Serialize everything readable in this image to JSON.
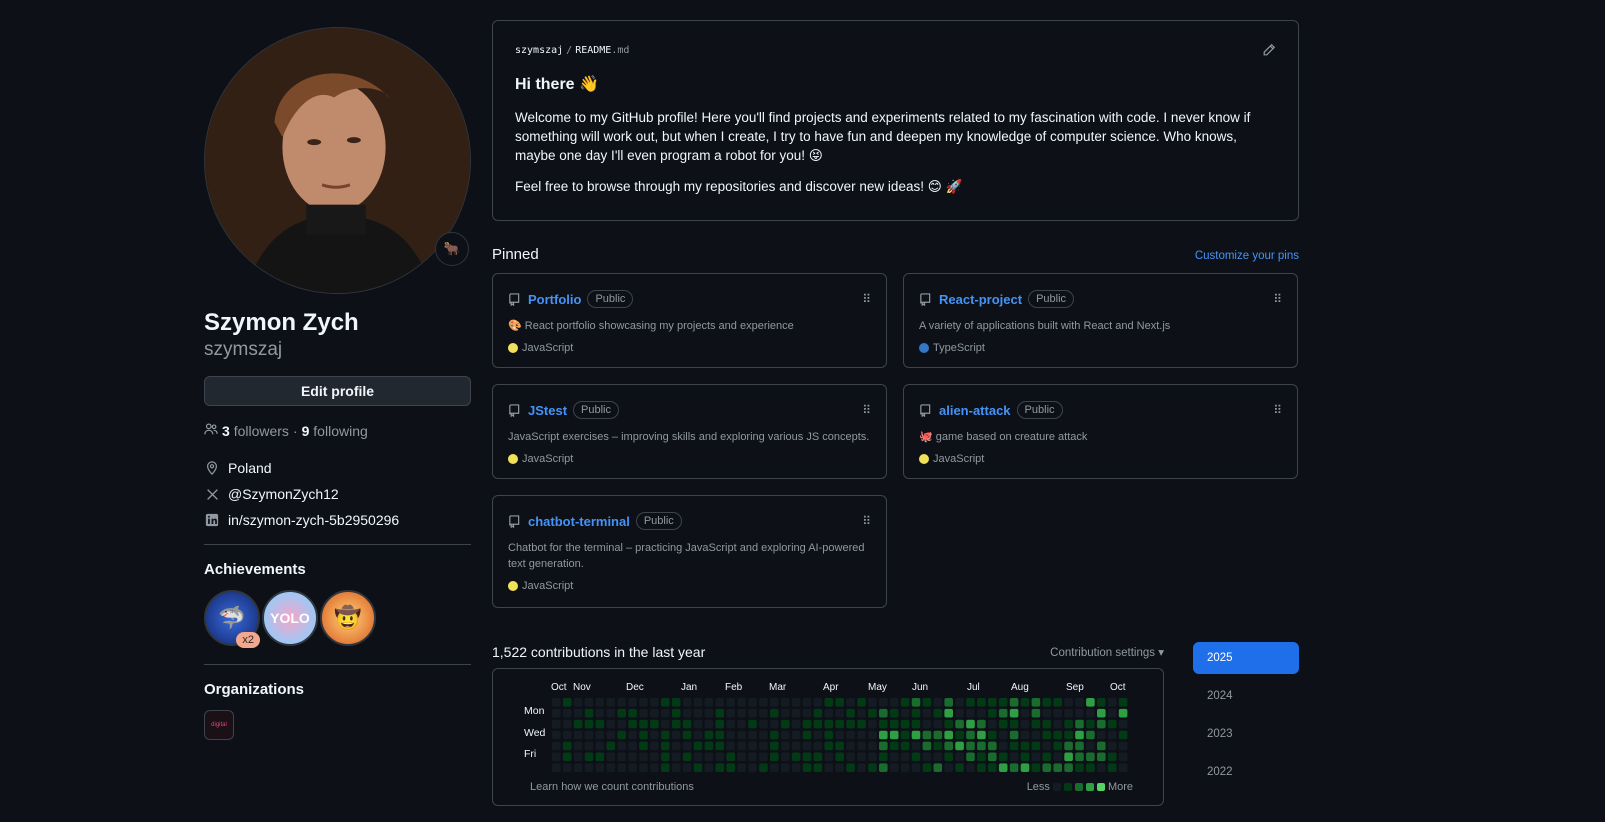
{
  "profile": {
    "full_name": "Szymon Zych",
    "login": "szymszaj",
    "edit_label": "Edit profile",
    "followers_count": "3",
    "followers_label": "followers",
    "following_count": "9",
    "following_label": "following",
    "location": "Poland",
    "twitter": "@SzymonZych12",
    "linkedin": "in/szymon-zych-5b2950296"
  },
  "achievements": {
    "title": "Achievements",
    "shark_count": "x2",
    "yolo_text": "YOLO"
  },
  "organizations": {
    "title": "Organizations",
    "org_text": "digital"
  },
  "readme": {
    "owner": "szymszaj",
    "sep": "/",
    "file": "README",
    "ext": ".md",
    "heading": "Hi there 👋",
    "p1": "Welcome to my GitHub profile! Here you'll find projects and experiments related to my fascination with code. I never know if something will work out, but when I create, I try to have fun and deepen my knowledge of computer science. Who knows, maybe one day I'll even program a robot for you! 😝",
    "p2": "Feel free to browse through my repositories and discover new ideas! 😊 🚀"
  },
  "pinned": {
    "title": "Pinned",
    "customize": "Customize your pins",
    "repos": [
      {
        "name": "Portfolio",
        "visibility": "Public",
        "desc": "🎨 React portfolio showcasing my projects and experience",
        "lang": "JavaScript",
        "color": "#f1e05a"
      },
      {
        "name": "React-project",
        "visibility": "Public",
        "desc": "A variety of applications built with React and Next.js",
        "lang": "TypeScript",
        "color": "#3178c6"
      },
      {
        "name": "JStest",
        "visibility": "Public",
        "desc": "JavaScript exercises – improving skills and exploring various JS concepts.",
        "lang": "JavaScript",
        "color": "#f1e05a"
      },
      {
        "name": "alien-attack",
        "visibility": "Public",
        "desc": "🐙 game based on creature attack",
        "lang": "JavaScript",
        "color": "#f1e05a"
      },
      {
        "name": "chatbot-terminal",
        "visibility": "Public",
        "desc": "Chatbot for the terminal – practicing JavaScript and exploring AI-powered text generation.",
        "lang": "JavaScript",
        "color": "#f1e05a"
      }
    ]
  },
  "contributions": {
    "title": "1,522 contributions in the last year",
    "settings": "Contribution settings",
    "months": [
      "Oct",
      "Nov",
      "Dec",
      "Jan",
      "Feb",
      "Mar",
      "Apr",
      "May",
      "Jun",
      "Jul",
      "Aug",
      "Sep",
      "Oct"
    ],
    "days": [
      "Mon",
      "Wed",
      "Fri"
    ],
    "learn": "Learn how we count contributions",
    "less": "Less",
    "more": "More",
    "levels": [
      "#151b23",
      "#033a16",
      "#196c2e",
      "#2ea043",
      "#56d364"
    ]
  },
  "years": [
    "2025",
    "2024",
    "2023",
    "2022"
  ]
}
